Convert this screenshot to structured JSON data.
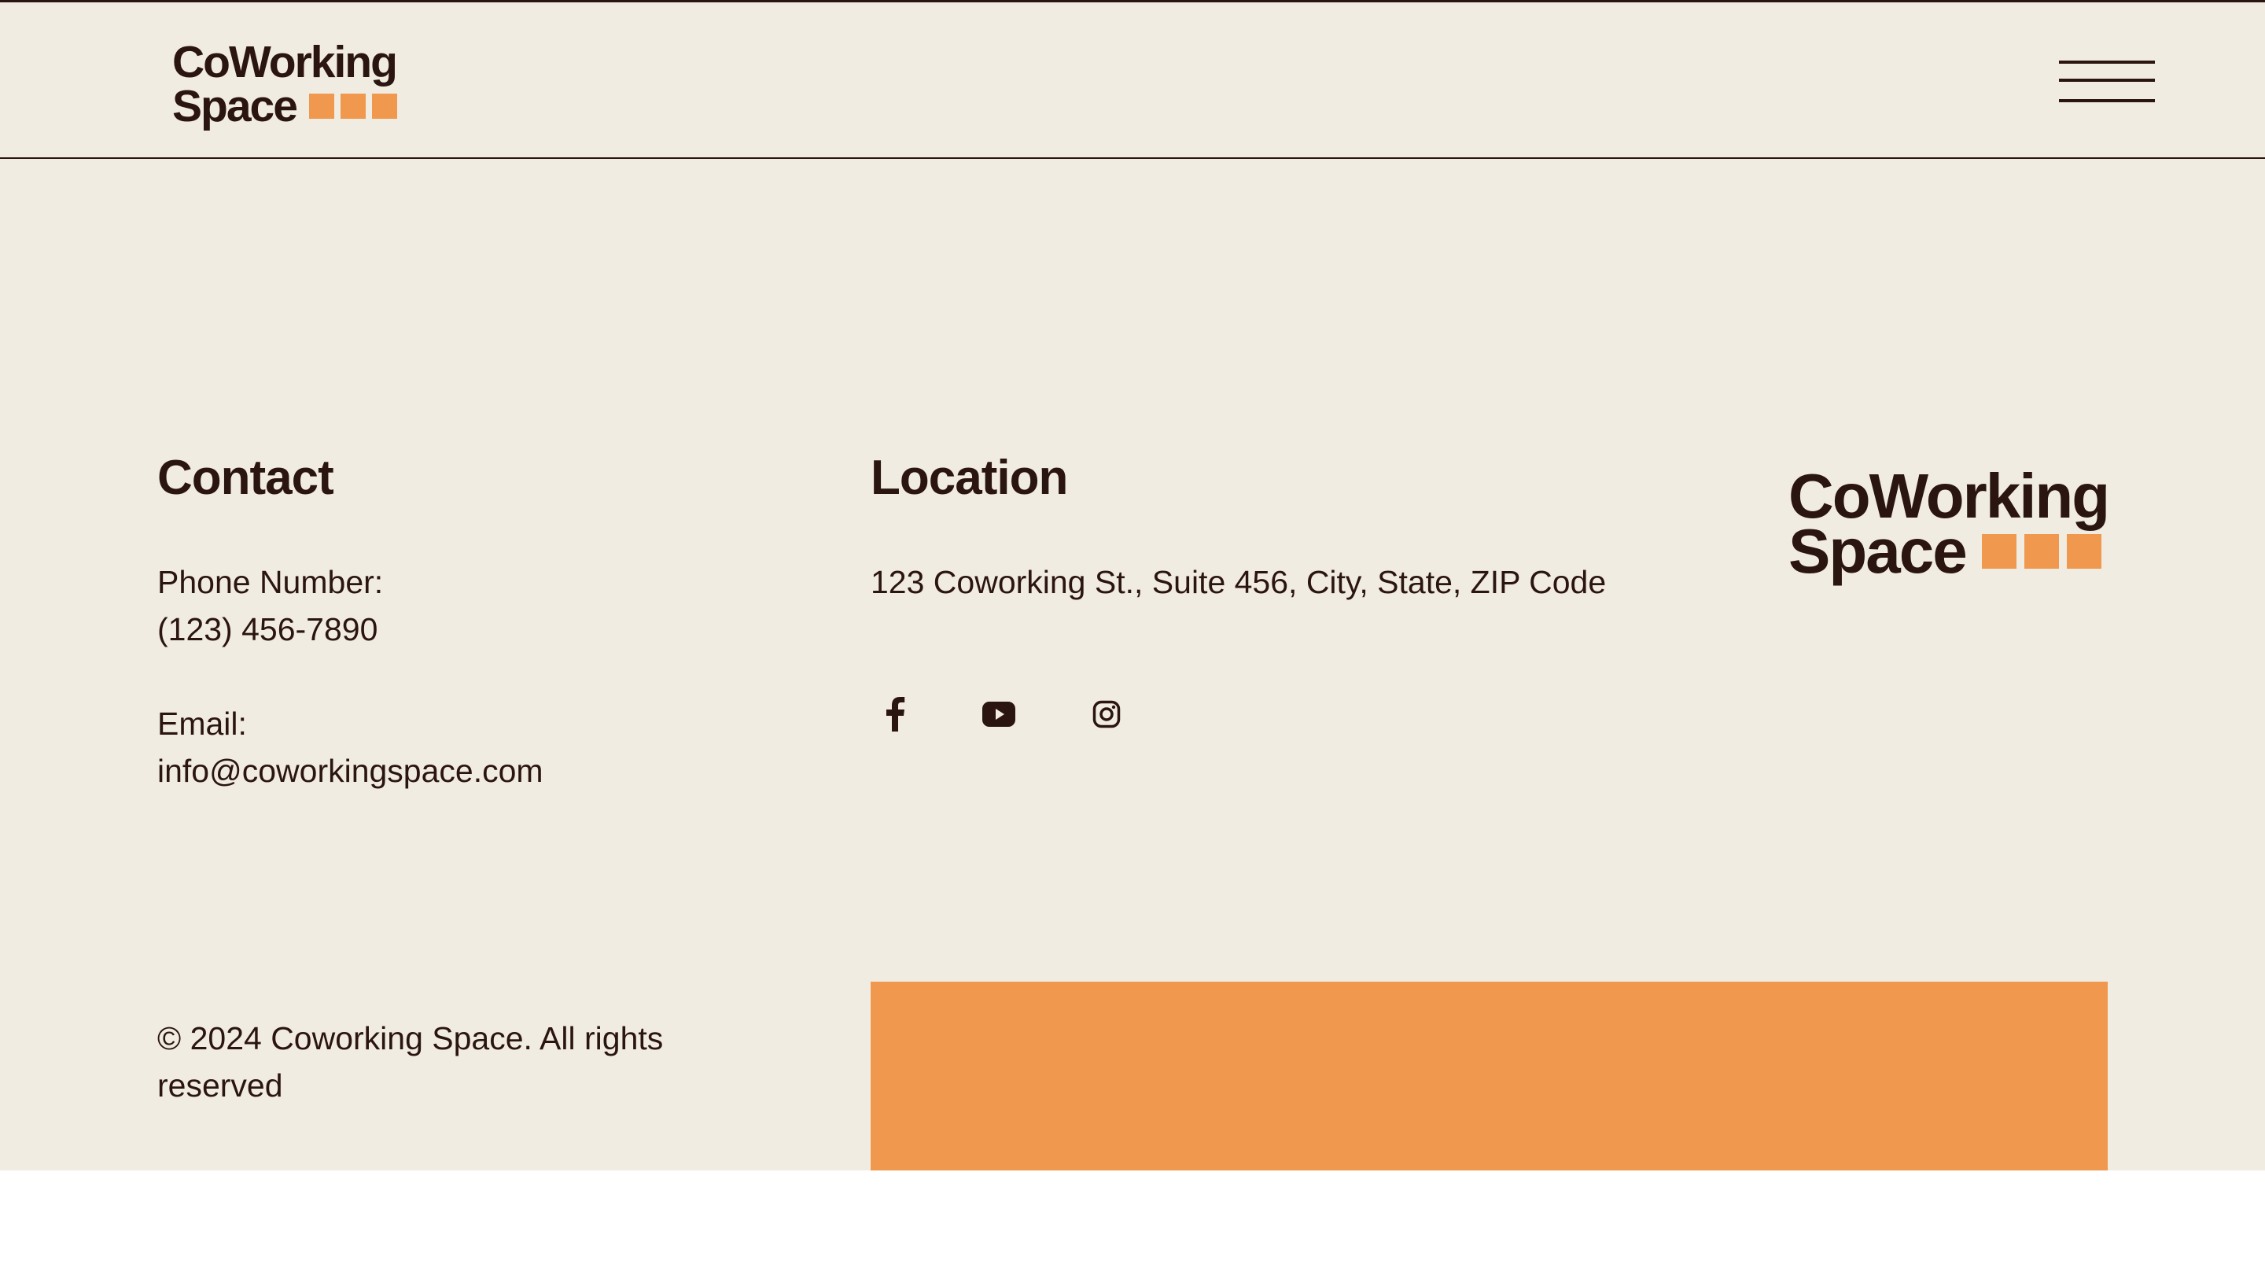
{
  "header": {
    "logo": {
      "line1": "CoWorking",
      "line2": "Space"
    },
    "menu_icon": "hamburger-menu-icon"
  },
  "contact": {
    "heading": "Contact",
    "phone_label": "Phone Number:",
    "phone_value": "(123) 456-7890",
    "email_label": "Email:",
    "email_value": "info@coworkingspace.com"
  },
  "location": {
    "heading": "Location",
    "address": "123 Coworking St., Suite 456, City, State, ZIP Code",
    "social": [
      {
        "icon": "facebook-icon"
      },
      {
        "icon": "youtube-icon"
      },
      {
        "icon": "instagram-icon"
      }
    ]
  },
  "footer": {
    "logo": {
      "line1": "CoWorking",
      "line2": "Space"
    },
    "copyright": "© 2024 Coworking Space. All rights reserved"
  },
  "colors": {
    "background": "#f1ece1",
    "text": "#2b1510",
    "accent": "#f0984d"
  }
}
